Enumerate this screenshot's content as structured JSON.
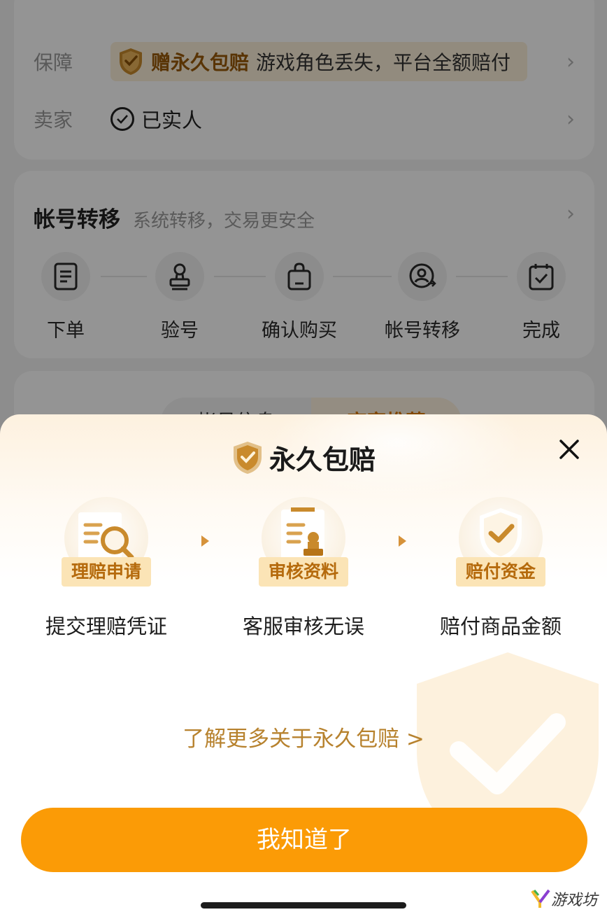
{
  "background_page": {
    "guarantee": {
      "label": "保障",
      "badge": "赠永久包赔",
      "text": "游戏角色丢失，平台全额赔付"
    },
    "seller": {
      "label": "卖家",
      "value": "已实人"
    },
    "transfer": {
      "title": "帐号转移",
      "subtitle": "系统转移，交易更安全",
      "steps": [
        {
          "label": "下单",
          "icon": "document-icon"
        },
        {
          "label": "验号",
          "icon": "stamp-icon"
        },
        {
          "label": "确认购买",
          "icon": "bag-icon"
        },
        {
          "label": "帐号转移",
          "icon": "user-transfer-icon"
        },
        {
          "label": "完成",
          "icon": "checked-calendar-icon"
        }
      ]
    },
    "tabs": [
      "帐号信息",
      "商家推荐"
    ]
  },
  "sheet": {
    "title": "永久包赔",
    "process": [
      {
        "tag": "理赔申请",
        "desc": "提交理赔凭证",
        "icon": "claim-search-icon"
      },
      {
        "tag": "审核资料",
        "desc": "客服审核无误",
        "icon": "document-stamp-icon"
      },
      {
        "tag": "赔付资金",
        "desc": "赔付商品金额",
        "icon": "shield-check-icon"
      }
    ],
    "learn_more": "了解更多关于永久包赔 >",
    "confirm_button": "我知道了"
  },
  "watermark": "游戏坊",
  "colors": {
    "accent": "#fb9b06",
    "tag_bg": "#fbe4b6",
    "tag_text": "#b56a0c",
    "link": "#b7822e"
  }
}
